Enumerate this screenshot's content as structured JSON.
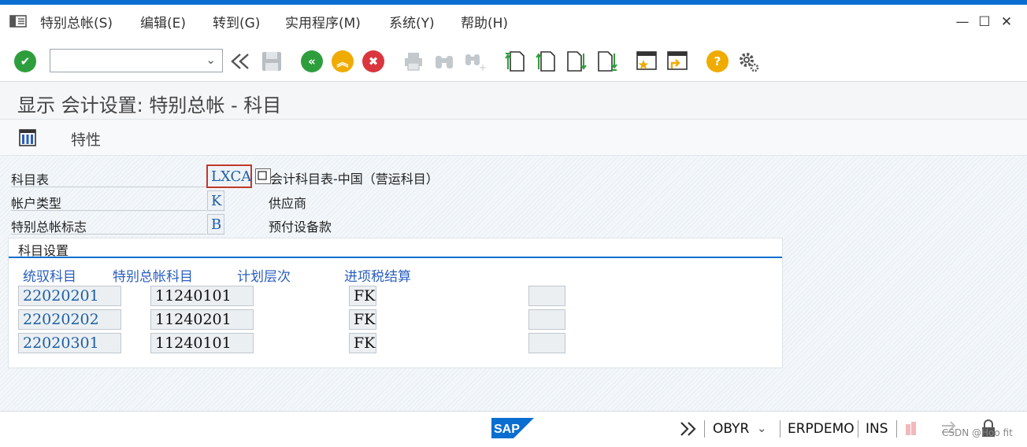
{
  "menu": {
    "items": [
      "特别总帐(S)",
      "编辑(E)",
      "转到(G)",
      "实用程序(M)",
      "系统(Y)",
      "帮助(H)"
    ]
  },
  "window": {
    "minimize": "—",
    "maximize": "☐",
    "close": "✕"
  },
  "toolbar": {
    "command_value": "",
    "command_placeholder": ""
  },
  "title": "显示 会计设置: 特别总帐 - 科目",
  "app_toolbar": {
    "properties_label": "特性"
  },
  "fields": {
    "chart_of_accounts": {
      "label": "科目表",
      "value": "LXCA",
      "description": "会计科目表-中国（营运科目）"
    },
    "account_type": {
      "label": "帐户类型",
      "value": "K",
      "description": "供应商"
    },
    "special_gl_indicator": {
      "label": "特别总帐标志",
      "value": "B",
      "description": "预付设备款"
    }
  },
  "account_settings": {
    "title": "科目设置",
    "columns": [
      "统驭科目",
      "特别总帐科目",
      "计划层次",
      "进项税结算"
    ],
    "rows": [
      {
        "recon": "22020201",
        "special_gl": "11240101",
        "planning_level": "",
        "tax": "FK",
        "extra": ""
      },
      {
        "recon": "22020202",
        "special_gl": "11240201",
        "planning_level": "",
        "tax": "FK",
        "extra": ""
      },
      {
        "recon": "22020301",
        "special_gl": "11240101",
        "planning_level": "",
        "tax": "FK",
        "extra": ""
      }
    ]
  },
  "status": {
    "logo": "SAP",
    "transaction": "OBYR",
    "system": "ERPDEMO",
    "mode": "INS",
    "watermark": "CSDN @Hoo fit"
  },
  "colors": {
    "accent": "#0a6ed1",
    "ok_green": "#2e9e3c",
    "back_green": "#2e9e3c",
    "up_yellow": "#f0ab00",
    "cancel_red": "#d9363e",
    "help_yellow": "#f0ab00",
    "link_blue": "#1b5fa6"
  }
}
